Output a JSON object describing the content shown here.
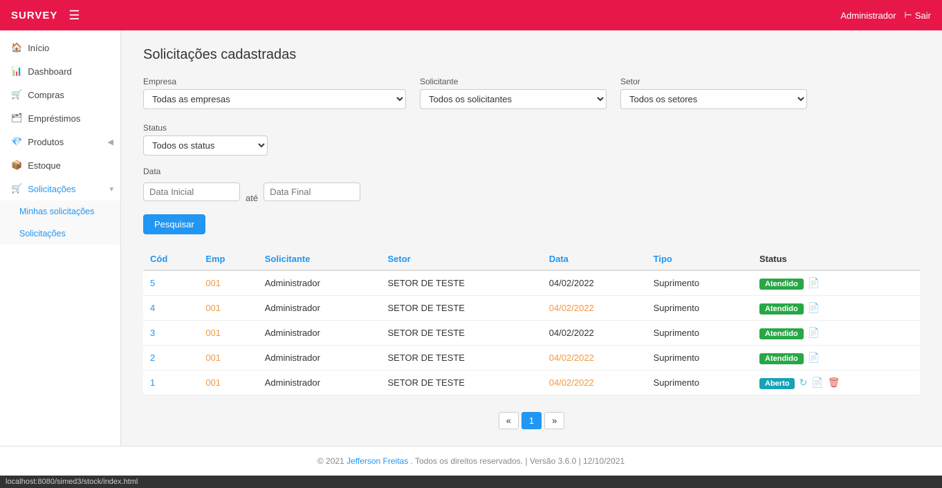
{
  "topnav": {
    "brand": "SURVEY",
    "hamburger": "☰",
    "user": "Administrador",
    "logout_label": "Sair",
    "logout_icon": "→"
  },
  "sidebar": {
    "items": [
      {
        "id": "inicio",
        "label": "Início",
        "icon": "🏠"
      },
      {
        "id": "dashboard",
        "label": "Dashboard",
        "icon": "📊"
      },
      {
        "id": "compras",
        "label": "Compras",
        "icon": "🛒"
      },
      {
        "id": "emprestimos",
        "label": "Empréstimos",
        "icon": "🗂"
      },
      {
        "id": "produtos",
        "label": "Produtos",
        "icon": "💎",
        "arrow": "◀"
      },
      {
        "id": "estoque",
        "label": "Estoque",
        "icon": "📦"
      },
      {
        "id": "solicitacoes",
        "label": "Solicitações",
        "icon": "🛒",
        "arrow": "▾",
        "active": true
      }
    ],
    "sub_items": [
      {
        "id": "minhas-solicitacoes",
        "label": "Minhas solicitações"
      },
      {
        "id": "solicitacoes",
        "label": "Solicitações"
      }
    ]
  },
  "page": {
    "title": "Solicitações cadastradas"
  },
  "filters": {
    "empresa_label": "Empresa",
    "empresa_placeholder": "Todas as empresas",
    "empresa_options": [
      "Todas as empresas"
    ],
    "solicitante_label": "Solicitante",
    "solicitante_placeholder": "Todos os solicitantes",
    "solicitante_options": [
      "Todos os solicitantes"
    ],
    "setor_label": "Setor",
    "setor_placeholder": "Todos os setores",
    "setor_options": [
      "Todos os setores"
    ],
    "status_label": "Status",
    "status_placeholder": "Todos os status",
    "status_options": [
      "Todos os status"
    ],
    "data_label": "Data",
    "data_inicial_placeholder": "Data Inicial",
    "data_final_placeholder": "Data Final",
    "ate_label": "até",
    "search_button": "Pesquisar"
  },
  "table": {
    "headers": [
      "Cód",
      "Emp",
      "Solicitante",
      "Setor",
      "Data",
      "Tipo",
      "Status"
    ],
    "rows": [
      {
        "cod": "5",
        "emp": "001",
        "solicitante": "Administrador",
        "setor": "SETOR DE TESTE",
        "data": "04/02/2022",
        "tipo": "Suprimento",
        "status": "Atendido",
        "status_type": "atendido",
        "actions": [
          "view"
        ]
      },
      {
        "cod": "4",
        "emp": "001",
        "solicitante": "Administrador",
        "setor": "SETOR DE TESTE",
        "data": "04/02/2022",
        "tipo": "Suprimento",
        "status": "Atendido",
        "status_type": "atendido",
        "actions": [
          "view"
        ]
      },
      {
        "cod": "3",
        "emp": "001",
        "solicitante": "Administrador",
        "setor": "SETOR DE TESTE",
        "data": "04/02/2022",
        "tipo": "Suprimento",
        "status": "Atendido",
        "status_type": "atendido",
        "actions": [
          "view"
        ]
      },
      {
        "cod": "2",
        "emp": "001",
        "solicitante": "Administrador",
        "setor": "SETOR DE TESTE",
        "data": "04/02/2022",
        "tipo": "Suprimento",
        "status": "Atendido",
        "status_type": "atendido",
        "actions": [
          "view"
        ]
      },
      {
        "cod": "1",
        "emp": "001",
        "solicitante": "Administrador",
        "setor": "SETOR DE TESTE",
        "data": "04/02/2022",
        "tipo": "Suprimento",
        "status": "Aberto",
        "status_type": "aberto",
        "actions": [
          "refresh",
          "view",
          "delete"
        ]
      }
    ]
  },
  "pagination": {
    "prev": "«",
    "next": "»",
    "current": "1",
    "pages": [
      "1"
    ]
  },
  "footer": {
    "copyright": "© 2021",
    "author": "Jefferson Freitas",
    "rights": ". Todos os direitos reservados. | Versão 3.6.0 | 12/10/2021"
  },
  "statusbar": {
    "url": "localhost:8080/simed3/stock/index.html"
  }
}
